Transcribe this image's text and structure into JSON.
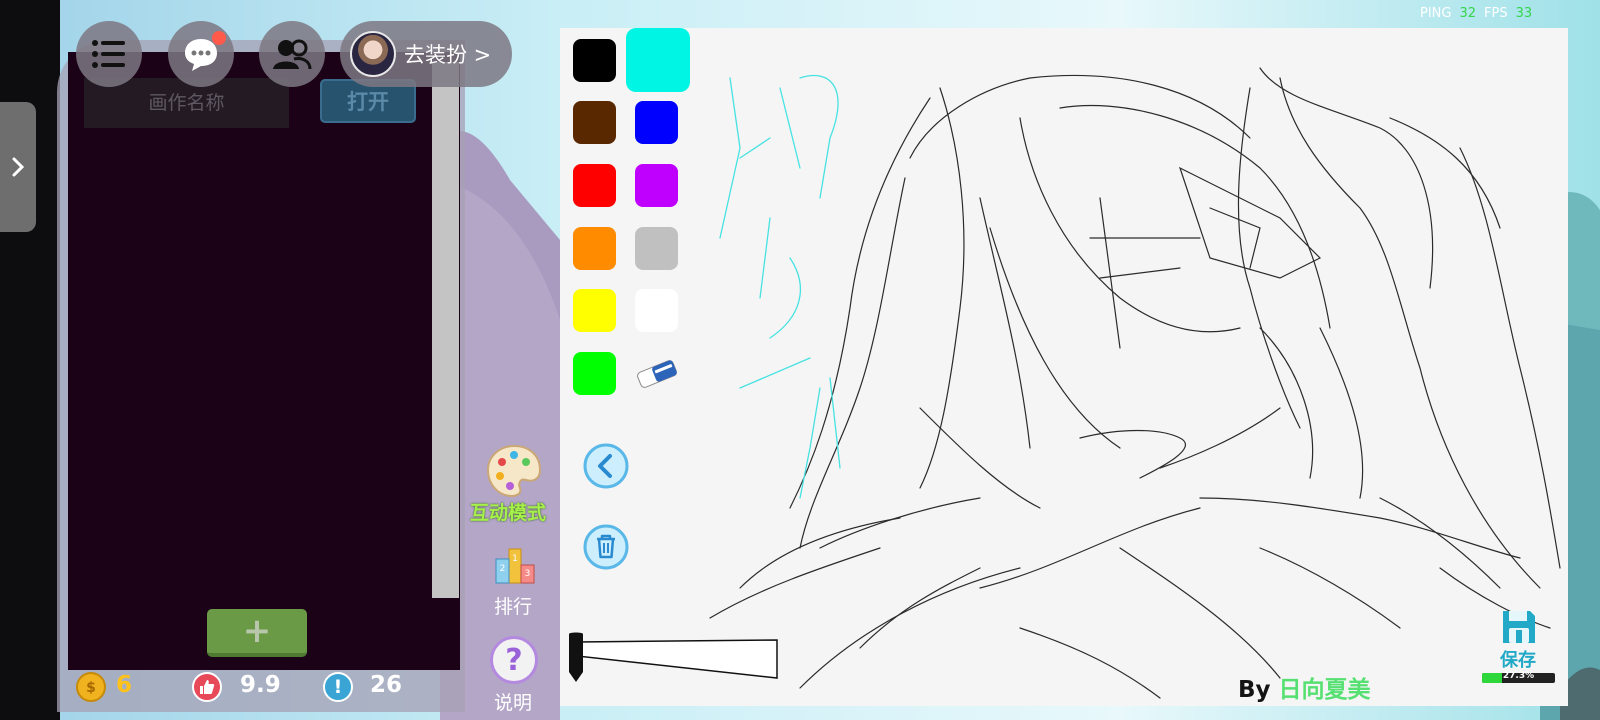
{
  "top_bar": {
    "dressup_label": "去装扮 >"
  },
  "gallery": {
    "name_placeholder": "画作名称",
    "open_label": "打开",
    "add_label": "+"
  },
  "stats": {
    "coins": "6",
    "rating": "9.9",
    "reports": "26"
  },
  "side_menu": {
    "interactive_mode": "互动模式",
    "ranking": "排行",
    "help": "说明"
  },
  "palette": {
    "selected": "#00f5e4",
    "colors": [
      "#000000",
      "#5a2800",
      "#0000ff",
      "#ff0000",
      "#c000ff",
      "#ff8c00",
      "#c0c0c0",
      "#ffff00",
      "#ffffff",
      "#00ff00"
    ]
  },
  "canvas": {
    "signature_prefix": "By ",
    "signature_name": "日向夏美",
    "save_label": "保存",
    "save_progress": 0.273,
    "save_progress_text": "27.3%"
  },
  "hud": {
    "ping_label": "PING",
    "ping_value": "32",
    "fps_label": "FPS",
    "fps_value": "33"
  },
  "icons": {
    "menu": "list-icon",
    "chat": "chat-bubble-icon",
    "friends": "friends-icon",
    "undo": "arrow-left-circle-icon",
    "trash": "trash-icon",
    "eraser": "eraser-icon",
    "save": "floppy-disk-icon"
  }
}
